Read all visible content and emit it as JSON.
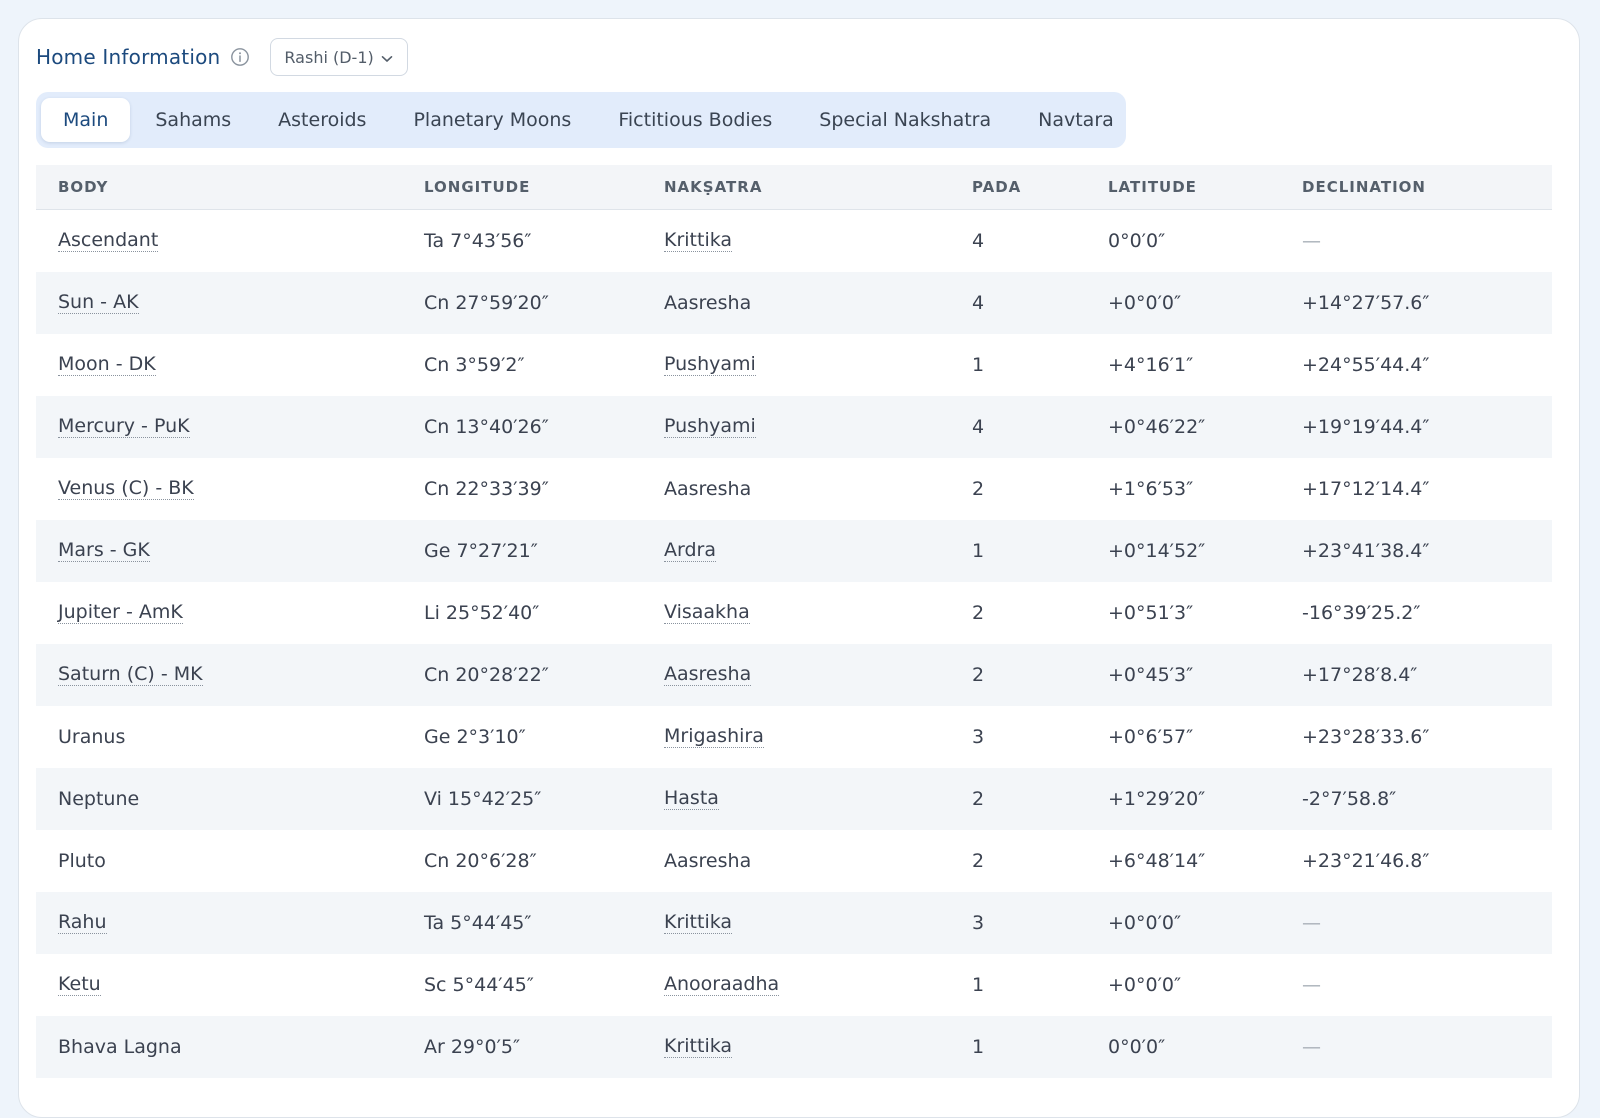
{
  "header": {
    "title": "Home Information",
    "chart_select": "Rashi (D-1)"
  },
  "tabs": [
    {
      "label": "Main",
      "active": true
    },
    {
      "label": "Sahams",
      "active": false
    },
    {
      "label": "Asteroids",
      "active": false
    },
    {
      "label": "Planetary Moons",
      "active": false
    },
    {
      "label": "Fictitious Bodies",
      "active": false
    },
    {
      "label": "Special Nakshatra",
      "active": false
    },
    {
      "label": "Navtara",
      "active": false
    }
  ],
  "table": {
    "columns": [
      "BODY",
      "LONGITUDE",
      "NAKṢATRA",
      "PADA",
      "LATITUDE",
      "DECLINATION"
    ],
    "rows": [
      {
        "body": "Ascendant",
        "longitude": "Ta 7°43′56″",
        "nakshatra": "Krittika",
        "pada": "4",
        "latitude": "0°0′0″",
        "declination": "—"
      },
      {
        "body": "Sun - AK",
        "longitude": "Cn 27°59′20″",
        "nakshatra": "Aasresha",
        "pada": "4",
        "latitude": "+0°0′0″",
        "declination": "+14°27′57.6″"
      },
      {
        "body": "Moon - DK",
        "longitude": "Cn 3°59′2″",
        "nakshatra": "Pushyami",
        "pada": "1",
        "latitude": "+4°16′1″",
        "declination": "+24°55′44.4″"
      },
      {
        "body": "Mercury - PuK",
        "longitude": "Cn 13°40′26″",
        "nakshatra": "Pushyami",
        "pada": "4",
        "latitude": "+0°46′22″",
        "declination": "+19°19′44.4″"
      },
      {
        "body": "Venus (C) - BK",
        "longitude": "Cn 22°33′39″",
        "nakshatra": "Aasresha",
        "pada": "2",
        "latitude": "+1°6′53″",
        "declination": "+17°12′14.4″"
      },
      {
        "body": "Mars - GK",
        "longitude": "Ge 7°27′21″",
        "nakshatra": "Ardra",
        "pada": "1",
        "latitude": "+0°14′52″",
        "declination": "+23°41′38.4″"
      },
      {
        "body": "Jupiter - AmK",
        "longitude": "Li 25°52′40″",
        "nakshatra": "Visaakha",
        "pada": "2",
        "latitude": "+0°51′3″",
        "declination": "-16°39′25.2″"
      },
      {
        "body": "Saturn (C) - MK",
        "longitude": "Cn 20°28′22″",
        "nakshatra": "Aasresha",
        "pada": "2",
        "latitude": "+0°45′3″",
        "declination": "+17°28′8.4″"
      },
      {
        "body": "Uranus",
        "longitude": "Ge 2°3′10″",
        "nakshatra": "Mrigashira",
        "pada": "3",
        "latitude": "+0°6′57″",
        "declination": "+23°28′33.6″"
      },
      {
        "body": "Neptune",
        "longitude": "Vi 15°42′25″",
        "nakshatra": "Hasta",
        "pada": "2",
        "latitude": "+1°29′20″",
        "declination": "-2°7′58.8″"
      },
      {
        "body": "Pluto",
        "longitude": "Cn 20°6′28″",
        "nakshatra": "Aasresha",
        "pada": "2",
        "latitude": "+6°48′14″",
        "declination": "+23°21′46.8″"
      },
      {
        "body": "Rahu",
        "longitude": "Ta 5°44′45″",
        "nakshatra": "Krittika",
        "pada": "3",
        "latitude": "+0°0′0″",
        "declination": "—"
      },
      {
        "body": "Ketu",
        "longitude": "Sc 5°44′45″",
        "nakshatra": "Anooraadha",
        "pada": "1",
        "latitude": "+0°0′0″",
        "declination": "—"
      },
      {
        "body": "Bhava Lagna",
        "longitude": "Ar 29°0′5″",
        "nakshatra": "Krittika",
        "pada": "1",
        "latitude": "0°0′0″",
        "declination": "—"
      }
    ]
  },
  "colors": {
    "accent": "#1c4a7e",
    "tab_bar_bg": "#e2ecfb",
    "row_alt_bg": "#f3f6f9",
    "page_bg": "#eef4fb"
  }
}
